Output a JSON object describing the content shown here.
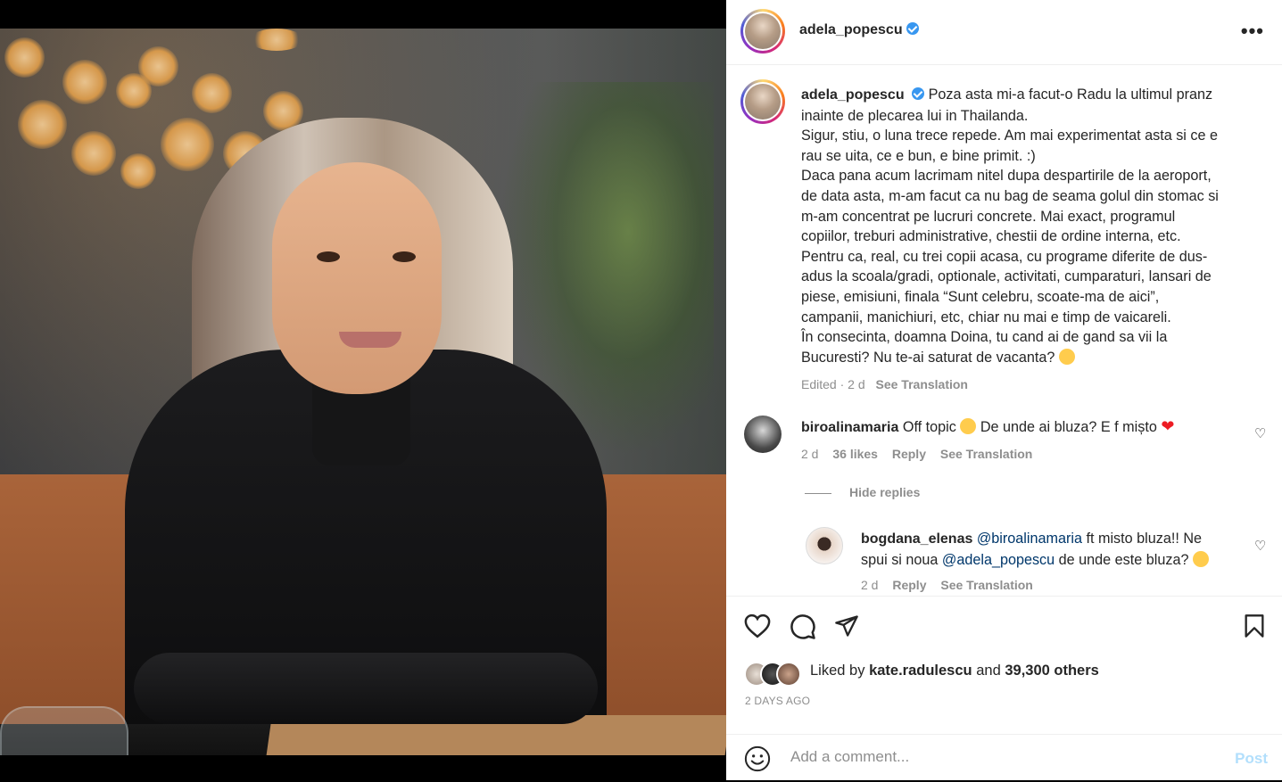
{
  "header": {
    "username": "adela_popescu"
  },
  "caption": {
    "username": "adela_popescu",
    "lines": [
      "Poza asta mi-a facut-o Radu la ultimul pranz",
      "inainte de plecarea lui in Thailanda.",
      "Sigur, stiu, o luna trece repede. Am mai experimentat asta si ce e",
      "rau se uita, ce e bun, e bine primit. :)",
      "Daca pana acum lacrimam nitel dupa despartirile de la aeroport,",
      "de data asta, m-am facut ca nu bag de seama golul din stomac si",
      "m-am concentrat pe lucruri concrete. Mai exact, programul",
      "copiilor, treburi administrative, chestii de ordine interna, etc.",
      "Pentru ca, real, cu trei copii acasa, cu programe diferite de dus-",
      "adus la scoala/gradi, optionale, activitati, cumparaturi, lansari de",
      "piese, emisiuni, finala “Sunt celebru, scoate-ma de aici”,",
      "campanii, manichiuri, etc, chiar nu mai e timp de vaicareli.",
      "În consecinta, doamna Doina, tu cand ai de gand sa vii la",
      "Bucuresti? Nu te-ai saturat de vacanta?"
    ],
    "edited": "Edited · 2 d",
    "see_translation": "See Translation"
  },
  "comments": [
    {
      "username": "biroalinamaria",
      "text_a": "Off topic",
      "text_b": "De unde ai bluza? E f mișto",
      "time": "2 d",
      "likes": "36 likes",
      "reply": "Reply",
      "see_translation": "See Translation",
      "hide_replies": "Hide replies"
    }
  ],
  "reply": {
    "username": "bogdana_elenas",
    "mention1": "@biroalinamaria",
    "text1": "ft misto bluza!! Ne",
    "text2": "spui si noua",
    "mention2": "@adela_popescu",
    "text3": "de unde este bluza?",
    "time": "2 d",
    "reply": "Reply",
    "see_translation": "See Translation"
  },
  "likes": {
    "prefix": "Liked by",
    "user": "kate.radulescu",
    "middle": "and",
    "others": "39,300 others"
  },
  "timestamp": "2 DAYS AGO",
  "add_comment": {
    "placeholder": "Add a comment...",
    "post_label": "Post"
  },
  "colors": {
    "verified": "#3897f0",
    "link": "#00376b",
    "post_disabled": "#b2dffc",
    "heart": "#ed1c24"
  }
}
